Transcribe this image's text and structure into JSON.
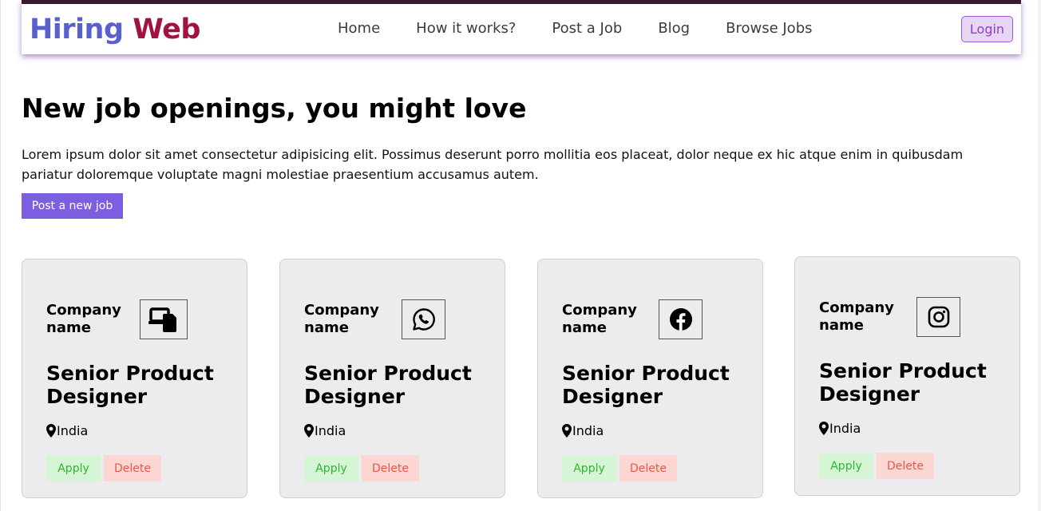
{
  "brand": {
    "part1": "Hiring",
    "part2": "Web"
  },
  "nav": {
    "links": [
      "Home",
      "How it works?",
      "Post a Job",
      "Blog",
      "Browse Jobs"
    ],
    "login_label": "Login"
  },
  "hero": {
    "title": "New job openings, you might love",
    "description": "Lorem ipsum dolor sit amet consectetur adipisicing elit. Possimus deserunt porro mollitia eos placeat, dolor neque ex hic atque enim in quibusdam pariatur doloremque voluptate magni molestiae praesentium accusamus autem.",
    "post_button_label": "Post a new job"
  },
  "jobs": [
    {
      "company": "Company name",
      "title": "Senior Product Designer",
      "location": "India",
      "apply_label": "Apply",
      "delete_label": "Delete",
      "icon": "devices-icon"
    },
    {
      "company": "Company name",
      "title": "Senior Product Designer",
      "location": "India",
      "apply_label": "Apply",
      "delete_label": "Delete",
      "icon": "whatsapp-icon"
    },
    {
      "company": "Company name",
      "title": "Senior Product Designer",
      "location": "India",
      "apply_label": "Apply",
      "delete_label": "Delete",
      "icon": "facebook-icon"
    },
    {
      "company": "Company name",
      "title": "Senior Product Designer",
      "location": "India",
      "apply_label": "Apply",
      "delete_label": "Delete",
      "icon": "instagram-icon"
    }
  ],
  "colors": {
    "brand_primary": "#5a5fd0",
    "brand_secondary": "#a0123f",
    "accent": "#7c5fe0",
    "apply_text": "#2db82d",
    "delete_text": "#e6584a"
  }
}
